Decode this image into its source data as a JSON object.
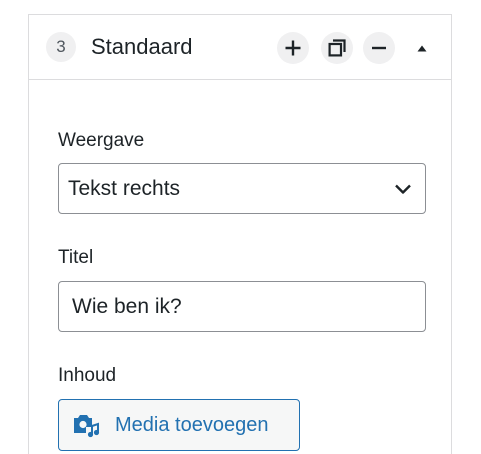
{
  "block": {
    "index": "3",
    "title": "Standaard"
  },
  "header_actions": [
    {
      "name": "add",
      "icon": "plus-icon"
    },
    {
      "name": "duplicate",
      "icon": "duplicate-icon"
    },
    {
      "name": "remove",
      "icon": "minus-icon"
    },
    {
      "name": "collapse",
      "icon": "triangle-up-icon"
    }
  ],
  "fields": {
    "weergave": {
      "label": "Weergave",
      "selected": "Tekst rechts"
    },
    "titel": {
      "label": "Titel",
      "value": "Wie ben ik?"
    },
    "inhoud": {
      "label": "Inhoud",
      "button_label": "Media toevoegen",
      "button_icon": "media-add-icon"
    }
  },
  "colors": {
    "accent": "#2271b1",
    "text": "#1d2327",
    "border": "#dcdcde",
    "input_border": "#8c8f94",
    "button_bg": "#f0f0f1"
  }
}
